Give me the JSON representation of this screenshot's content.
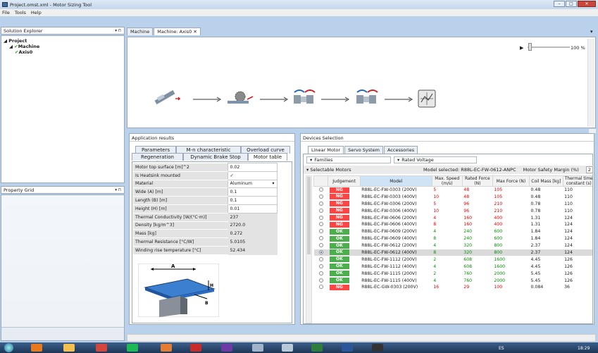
{
  "window": {
    "title": "Project.omst.xml - Motor Sizing Tool",
    "center_title": ""
  },
  "menu": [
    "File",
    "Tools",
    "Help"
  ],
  "solution_explorer": {
    "title": "Solution Explorer",
    "pin": "▾ ⊓",
    "tree": [
      "Project",
      "Machine",
      "Axis0"
    ]
  },
  "property_grid": {
    "title": "Property Grid",
    "pin": "▾ ⊓"
  },
  "doc_tabs": [
    "Machine",
    "Machine: Axis0"
  ],
  "doc_tab_close": "✕",
  "doc_tab_menu": "▾",
  "flow": {
    "zoom": "100 %",
    "play": "▶"
  },
  "app_results": {
    "title": "Application results",
    "tabs_row1": [
      "Parameters",
      "M-n characteristic",
      "Overload curve"
    ],
    "tabs_row2": [
      "Regeneration Resistor",
      "Dynamic Brake Stop",
      "Motor table"
    ],
    "rows": [
      {
        "label": "Motor top surface [m]^2",
        "value": "0.02",
        "ro": false
      },
      {
        "label": "Is Heatsink mounted",
        "value": "✓",
        "ro": false
      },
      {
        "label": "Material",
        "value": "Aluminum",
        "ro": false
      },
      {
        "label": "Wide (A) [m]",
        "value": "0.1",
        "ro": false
      },
      {
        "label": "Length (B) [m]",
        "value": "0.1",
        "ro": false
      },
      {
        "label": "Height (H) [m]",
        "value": "0.01",
        "ro": false
      },
      {
        "label": "Thermal Conductivity [W/(°C·m)]",
        "value": "237",
        "ro": true
      },
      {
        "label": "Density [kg/m^3]",
        "value": "2720.0",
        "ro": true
      },
      {
        "label": "Mass [kg]",
        "value": "0.272",
        "ro": true
      },
      {
        "label": "Thermal Resistance [°C/W]",
        "value": "5.0105",
        "ro": true
      },
      {
        "label": "Winding rise temperature [°C]",
        "value": "52.434",
        "ro": true
      }
    ],
    "diagram_labels": {
      "a": "A",
      "b": "B",
      "h": "H"
    }
  },
  "devices": {
    "title": "Devices Selection",
    "tabs": [
      "Linear Motor",
      "Servo System",
      "Accessories"
    ],
    "families_label": "Families",
    "rated_voltage_label": "Rated Voltage",
    "selectable_label": "Selectable Motors",
    "model_selected": "Model selected:  R88L-EC-FW-0612-ANPC",
    "safety_margin": "Motor Safety Margin (%)",
    "safety_value": "2",
    "columns": [
      "",
      "Judgement",
      "Model",
      "Max. Speed (m/s)",
      "Rated Force (N)",
      "Max Force (N)",
      "Coil Mass [kg]",
      "Thermal time constant (s)"
    ],
    "rows": [
      {
        "j": "NG",
        "model": "R88L-EC-FW-0303 (200V)",
        "speed": "5",
        "rated": "48",
        "max": "105",
        "mass": "0.48",
        "ttc": "110",
        "sel": false
      },
      {
        "j": "NG",
        "model": "R88L-EC-FW-0303 (400V)",
        "speed": "10",
        "rated": "48",
        "max": "105",
        "mass": "0.48",
        "ttc": "110",
        "sel": false
      },
      {
        "j": "NG",
        "model": "R88L-EC-FW-0306 (200V)",
        "speed": "5",
        "rated": "96",
        "max": "210",
        "mass": "0.78",
        "ttc": "110",
        "sel": false
      },
      {
        "j": "NG",
        "model": "R88L-EC-FW-0306 (400V)",
        "speed": "10",
        "rated": "96",
        "max": "210",
        "mass": "0.78",
        "ttc": "110",
        "sel": false
      },
      {
        "j": "NG",
        "model": "R88L-EC-FW-0606 (200V)",
        "speed": "4",
        "rated": "160",
        "max": "400",
        "mass": "1.31",
        "ttc": "124",
        "sel": false
      },
      {
        "j": "NG",
        "model": "R88L-EC-FW-0606 (400V)",
        "speed": "8",
        "rated": "160",
        "max": "400",
        "mass": "1.31",
        "ttc": "124",
        "sel": false
      },
      {
        "j": "OK",
        "model": "R88L-EC-FW-0609 (200V)",
        "speed": "4",
        "rated": "240",
        "max": "600",
        "mass": "1.84",
        "ttc": "124",
        "sel": false
      },
      {
        "j": "OK",
        "model": "R88L-EC-FW-0609 (400V)",
        "speed": "8",
        "rated": "240",
        "max": "600",
        "mass": "1.84",
        "ttc": "124",
        "sel": false
      },
      {
        "j": "OK",
        "model": "R88L-EC-FW-0612 (200V)",
        "speed": "4",
        "rated": "320",
        "max": "800",
        "mass": "2.37",
        "ttc": "124",
        "sel": false
      },
      {
        "j": "OK",
        "model": "R88L-EC-FW-0612 (400V)",
        "speed": "8",
        "rated": "320",
        "max": "800",
        "mass": "2.37",
        "ttc": "124",
        "sel": true
      },
      {
        "j": "OK",
        "model": "R88L-EC-FW-1112 (200V)",
        "speed": "2",
        "rated": "608",
        "max": "1600",
        "mass": "4.45",
        "ttc": "126",
        "sel": false
      },
      {
        "j": "OK",
        "model": "R88L-EC-FW-1112 (400V)",
        "speed": "4",
        "rated": "608",
        "max": "1600",
        "mass": "4.45",
        "ttc": "126",
        "sel": false
      },
      {
        "j": "OK",
        "model": "R88L-EC-FW-1115 (200V)",
        "speed": "2",
        "rated": "760",
        "max": "2000",
        "mass": "5.45",
        "ttc": "126",
        "sel": false
      },
      {
        "j": "OK",
        "model": "R88L-EC-FW-1115 (400V)",
        "speed": "4",
        "rated": "760",
        "max": "2000",
        "mass": "5.45",
        "ttc": "126",
        "sel": false
      },
      {
        "j": "NG",
        "model": "R88L-EC-GW-0303 (200V)",
        "speed": "16",
        "rated": "29",
        "max": "100",
        "mass": "0.084",
        "ttc": "36",
        "sel": false
      }
    ]
  },
  "taskbar": {
    "lang": "ES",
    "time": "18:29"
  },
  "colors": {
    "ng": "#ff4444",
    "ok": "#4cae4c",
    "accent": "#2a64b8"
  }
}
